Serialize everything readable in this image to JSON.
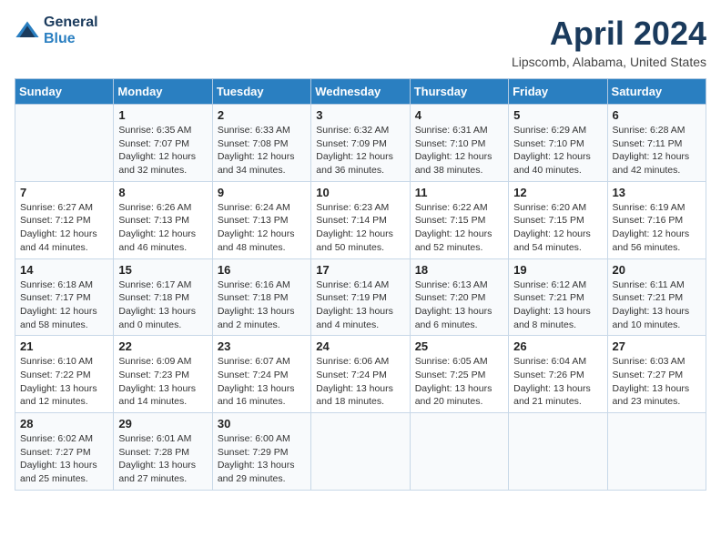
{
  "header": {
    "logo_line1": "General",
    "logo_line2": "Blue",
    "title": "April 2024",
    "subtitle": "Lipscomb, Alabama, United States"
  },
  "weekdays": [
    "Sunday",
    "Monday",
    "Tuesday",
    "Wednesday",
    "Thursday",
    "Friday",
    "Saturday"
  ],
  "weeks": [
    [
      {
        "day": "",
        "info": ""
      },
      {
        "day": "1",
        "info": "Sunrise: 6:35 AM\nSunset: 7:07 PM\nDaylight: 12 hours\nand 32 minutes."
      },
      {
        "day": "2",
        "info": "Sunrise: 6:33 AM\nSunset: 7:08 PM\nDaylight: 12 hours\nand 34 minutes."
      },
      {
        "day": "3",
        "info": "Sunrise: 6:32 AM\nSunset: 7:09 PM\nDaylight: 12 hours\nand 36 minutes."
      },
      {
        "day": "4",
        "info": "Sunrise: 6:31 AM\nSunset: 7:10 PM\nDaylight: 12 hours\nand 38 minutes."
      },
      {
        "day": "5",
        "info": "Sunrise: 6:29 AM\nSunset: 7:10 PM\nDaylight: 12 hours\nand 40 minutes."
      },
      {
        "day": "6",
        "info": "Sunrise: 6:28 AM\nSunset: 7:11 PM\nDaylight: 12 hours\nand 42 minutes."
      }
    ],
    [
      {
        "day": "7",
        "info": "Sunrise: 6:27 AM\nSunset: 7:12 PM\nDaylight: 12 hours\nand 44 minutes."
      },
      {
        "day": "8",
        "info": "Sunrise: 6:26 AM\nSunset: 7:13 PM\nDaylight: 12 hours\nand 46 minutes."
      },
      {
        "day": "9",
        "info": "Sunrise: 6:24 AM\nSunset: 7:13 PM\nDaylight: 12 hours\nand 48 minutes."
      },
      {
        "day": "10",
        "info": "Sunrise: 6:23 AM\nSunset: 7:14 PM\nDaylight: 12 hours\nand 50 minutes."
      },
      {
        "day": "11",
        "info": "Sunrise: 6:22 AM\nSunset: 7:15 PM\nDaylight: 12 hours\nand 52 minutes."
      },
      {
        "day": "12",
        "info": "Sunrise: 6:20 AM\nSunset: 7:15 PM\nDaylight: 12 hours\nand 54 minutes."
      },
      {
        "day": "13",
        "info": "Sunrise: 6:19 AM\nSunset: 7:16 PM\nDaylight: 12 hours\nand 56 minutes."
      }
    ],
    [
      {
        "day": "14",
        "info": "Sunrise: 6:18 AM\nSunset: 7:17 PM\nDaylight: 12 hours\nand 58 minutes."
      },
      {
        "day": "15",
        "info": "Sunrise: 6:17 AM\nSunset: 7:18 PM\nDaylight: 13 hours\nand 0 minutes."
      },
      {
        "day": "16",
        "info": "Sunrise: 6:16 AM\nSunset: 7:18 PM\nDaylight: 13 hours\nand 2 minutes."
      },
      {
        "day": "17",
        "info": "Sunrise: 6:14 AM\nSunset: 7:19 PM\nDaylight: 13 hours\nand 4 minutes."
      },
      {
        "day": "18",
        "info": "Sunrise: 6:13 AM\nSunset: 7:20 PM\nDaylight: 13 hours\nand 6 minutes."
      },
      {
        "day": "19",
        "info": "Sunrise: 6:12 AM\nSunset: 7:21 PM\nDaylight: 13 hours\nand 8 minutes."
      },
      {
        "day": "20",
        "info": "Sunrise: 6:11 AM\nSunset: 7:21 PM\nDaylight: 13 hours\nand 10 minutes."
      }
    ],
    [
      {
        "day": "21",
        "info": "Sunrise: 6:10 AM\nSunset: 7:22 PM\nDaylight: 13 hours\nand 12 minutes."
      },
      {
        "day": "22",
        "info": "Sunrise: 6:09 AM\nSunset: 7:23 PM\nDaylight: 13 hours\nand 14 minutes."
      },
      {
        "day": "23",
        "info": "Sunrise: 6:07 AM\nSunset: 7:24 PM\nDaylight: 13 hours\nand 16 minutes."
      },
      {
        "day": "24",
        "info": "Sunrise: 6:06 AM\nSunset: 7:24 PM\nDaylight: 13 hours\nand 18 minutes."
      },
      {
        "day": "25",
        "info": "Sunrise: 6:05 AM\nSunset: 7:25 PM\nDaylight: 13 hours\nand 20 minutes."
      },
      {
        "day": "26",
        "info": "Sunrise: 6:04 AM\nSunset: 7:26 PM\nDaylight: 13 hours\nand 21 minutes."
      },
      {
        "day": "27",
        "info": "Sunrise: 6:03 AM\nSunset: 7:27 PM\nDaylight: 13 hours\nand 23 minutes."
      }
    ],
    [
      {
        "day": "28",
        "info": "Sunrise: 6:02 AM\nSunset: 7:27 PM\nDaylight: 13 hours\nand 25 minutes."
      },
      {
        "day": "29",
        "info": "Sunrise: 6:01 AM\nSunset: 7:28 PM\nDaylight: 13 hours\nand 27 minutes."
      },
      {
        "day": "30",
        "info": "Sunrise: 6:00 AM\nSunset: 7:29 PM\nDaylight: 13 hours\nand 29 minutes."
      },
      {
        "day": "",
        "info": ""
      },
      {
        "day": "",
        "info": ""
      },
      {
        "day": "",
        "info": ""
      },
      {
        "day": "",
        "info": ""
      }
    ]
  ]
}
